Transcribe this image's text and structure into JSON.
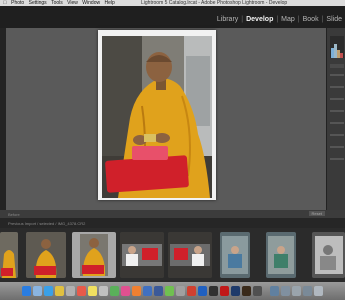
{
  "menubar": {
    "apple": "",
    "items": [
      "Photo",
      "Settings",
      "Tools",
      "View",
      "Window",
      "Help"
    ],
    "window_title": "Lightroom 5 Catalog.lrcat - Adobe Photoshop Lightroom - Develop"
  },
  "modules": [
    "Library",
    "Develop",
    "Map",
    "Book",
    "Slide"
  ],
  "active_module": "Develop",
  "toolbar": {
    "left_label": "Before",
    "right_label": "Reset"
  },
  "filmstrip": {
    "path": "Previous Import / selected / IMG_4378.CR2",
    "thumb_count": 9,
    "selected_index": 2
  },
  "colors": {
    "accent_robe": "#e0a21c",
    "cushion": "#d0202a",
    "panel_bg": "#5a5a5a"
  }
}
